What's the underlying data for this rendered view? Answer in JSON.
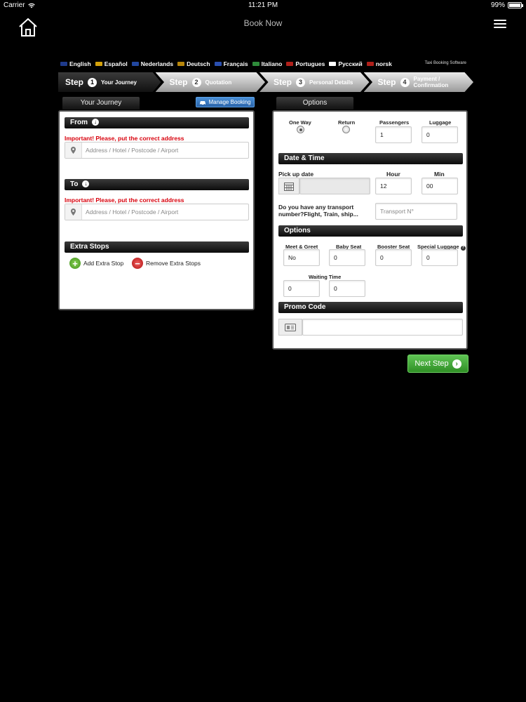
{
  "status": {
    "carrier": "Carrier",
    "time": "11:21 PM",
    "battery": "99%",
    "battery_level": 0.99
  },
  "nav": {
    "title": "Book Now"
  },
  "languages": [
    {
      "label": "English",
      "color": "#1f3b8c"
    },
    {
      "label": "Español",
      "color": "#d4a10a"
    },
    {
      "label": "Nederlands",
      "color": "#2247a0"
    },
    {
      "label": "Deutsch",
      "color": "#b8860b"
    },
    {
      "label": "Français",
      "color": "#2a4fb0"
    },
    {
      "label": "Italiano",
      "color": "#2e8b3a"
    },
    {
      "label": "Portugues",
      "color": "#b0201a"
    },
    {
      "label": "Русский",
      "color": "#ffffff"
    },
    {
      "label": "norsk",
      "color": "#b0201a"
    }
  ],
  "powered_by": "Taxi Booking Software",
  "steps": [
    {
      "word": "Step",
      "num": "1",
      "label": "Your Journey"
    },
    {
      "word": "Step",
      "num": "2",
      "label": "Quotation"
    },
    {
      "word": "Step",
      "num": "3",
      "label": "Personal Details"
    },
    {
      "word": "Step",
      "num": "4",
      "label": "Payment / Confirmation"
    }
  ],
  "journey": {
    "tab": "Your Journey",
    "manage": "Manage Booking",
    "from_label": "From",
    "to_label": "To",
    "warning": "Important! Please, put the correct address",
    "address_placeholder": "Address / Hotel / Postcode / Airport",
    "extra_stops": "Extra Stops",
    "add_stop": "Add Extra Stop",
    "remove_stops": "Remove Extra Stops"
  },
  "options": {
    "tab": "Options",
    "one_way": "One Way",
    "return": "Return",
    "passengers_label": "Passengers",
    "passengers": "1",
    "luggage_label": "Luggage",
    "luggage": "0",
    "date_time": "Date & Time",
    "pickup_date": "Pick up date",
    "hour_label": "Hour",
    "hour": "12",
    "min_label": "Min",
    "min": "00",
    "transport_question": "Do you have any transport number?Flight, Train, ship...",
    "transport_placeholder": "Transport N°",
    "options_header": "Options",
    "meet_label": "Meet & Greet",
    "meet": "No",
    "baby_label": "Baby Seat",
    "baby": "0",
    "booster_label": "Booster Seat",
    "booster": "0",
    "special_label": "Special Luggage",
    "special": "0",
    "waiting_label": "Waiting Time",
    "waiting_h": "0",
    "waiting_m": "0",
    "promo": "Promo Code"
  },
  "next": "Next Step"
}
